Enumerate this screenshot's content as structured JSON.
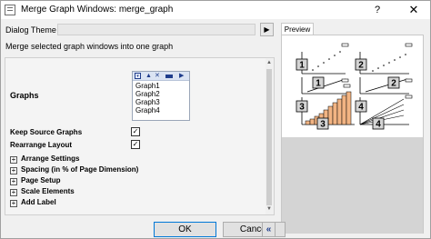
{
  "window": {
    "title": "Merge Graph Windows: merge_graph",
    "help": "?",
    "close": "✕"
  },
  "theme": {
    "label": "Dialog Theme",
    "value": ""
  },
  "description": "Merge selected graph windows into one graph",
  "settings": {
    "graphs_label": "Graphs",
    "graph_list": [
      "Graph1",
      "Graph2",
      "Graph3",
      "Graph4"
    ],
    "keep_source_label": "Keep Source Graphs",
    "keep_source_checked": true,
    "rearrange_label": "Rearrange Layout",
    "rearrange_checked": true,
    "expanders": [
      "Arrange Settings",
      "Spacing (in % of Page Dimension)",
      "Page Setup",
      "Scale Elements",
      "Add Label"
    ]
  },
  "preview": {
    "tab_label": "Preview",
    "panel_numbers": [
      "1",
      "2",
      "1",
      "2",
      "3",
      "4",
      "3",
      "4"
    ]
  },
  "buttons": {
    "ok": "OK",
    "cancel": "Cancel",
    "collapse": "«"
  },
  "icons": {
    "check": "✓",
    "plus": "+",
    "arrow_right": "▶"
  }
}
